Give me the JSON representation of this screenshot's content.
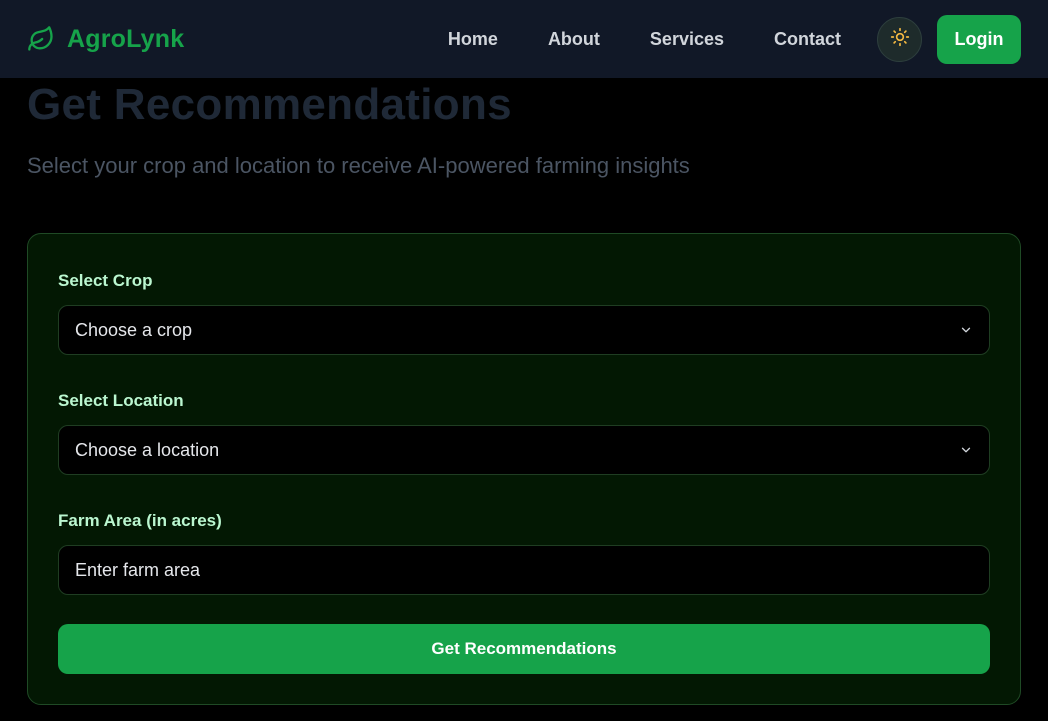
{
  "header": {
    "brand_name": "AgroLynk",
    "brand_icon": "leaf-icon",
    "nav": [
      "Home",
      "About",
      "Services",
      "Contact"
    ],
    "theme_icon": "sun-icon",
    "login_label": "Login"
  },
  "main": {
    "title": "Get Recommendations",
    "subtitle": "Select your crop and location to receive AI-powered farming insights"
  },
  "form": {
    "crop_label": "Select Crop",
    "crop_value": "Choose a crop",
    "location_label": "Select Location",
    "location_value": "Choose a location",
    "area_label": "Farm Area (in acres)",
    "area_placeholder": "Enter farm area",
    "submit_label": "Get Recommendations"
  },
  "colors": {
    "accent": "#16a34a",
    "header_bg": "#111827",
    "card_bg": "#031803",
    "label": "#bbf7d0"
  }
}
